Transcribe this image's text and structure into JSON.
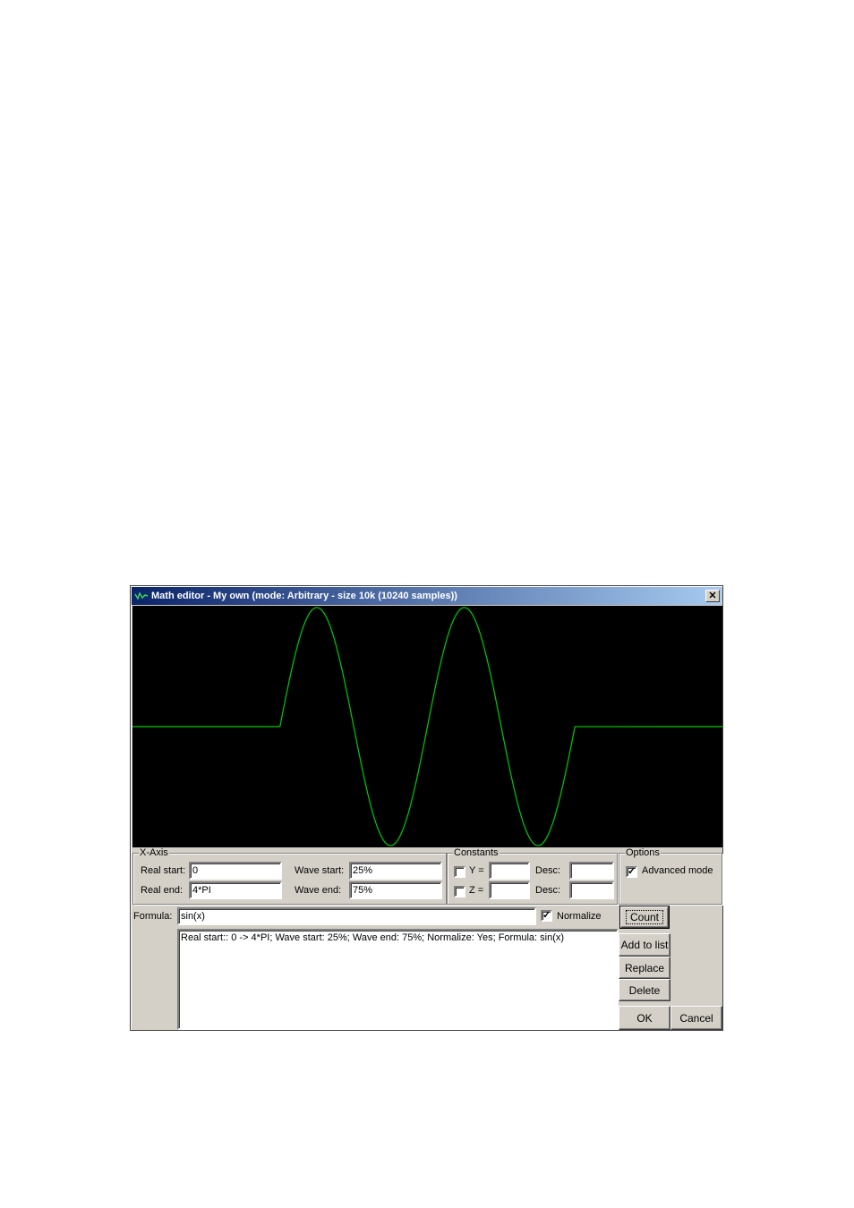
{
  "window": {
    "title": "Math editor - My own (mode: Arbitrary - size 10k (10240 samples))",
    "app_icon": "waveform-app-icon",
    "close_label": "✕"
  },
  "plot": {
    "background": "#000000",
    "trace_color": "#00cc00",
    "formula": "sin(x)",
    "real_start": 0,
    "real_end_radians": 12.566,
    "wave_start_fraction": 0.25,
    "wave_end_fraction": 0.75,
    "normalized": true
  },
  "x_axis": {
    "legend": "X-Axis",
    "real_start_label": "Real start:",
    "real_start_value": "0",
    "real_end_label": "Real end:",
    "real_end_value": "4*PI",
    "wave_start_label": "Wave start:",
    "wave_start_value": "25%",
    "wave_end_label": "Wave end:",
    "wave_end_value": "75%"
  },
  "constants": {
    "legend": "Constants",
    "items": [
      {
        "label": "Y =",
        "checked": false,
        "value": "",
        "desc_label": "Desc:",
        "desc_value": ""
      },
      {
        "label": "Z =",
        "checked": false,
        "value": "",
        "desc_label": "Desc:",
        "desc_value": ""
      }
    ]
  },
  "options": {
    "legend": "Options",
    "advanced_mode_label": "Advanced mode",
    "advanced_mode_checked": true
  },
  "formula": {
    "label": "Formula:",
    "value": "sin(x)",
    "normalize_label": "Normalize",
    "normalize_checked": true
  },
  "list": {
    "items": [
      "Real start:: 0 -> 4*PI; Wave start: 25%; Wave end: 75%; Normalize: Yes; Formula: sin(x)"
    ]
  },
  "buttons": {
    "count": "Count",
    "add_to_list": "Add to list",
    "replace": "Replace",
    "delete": "Delete",
    "ok": "OK",
    "cancel": "Cancel"
  }
}
